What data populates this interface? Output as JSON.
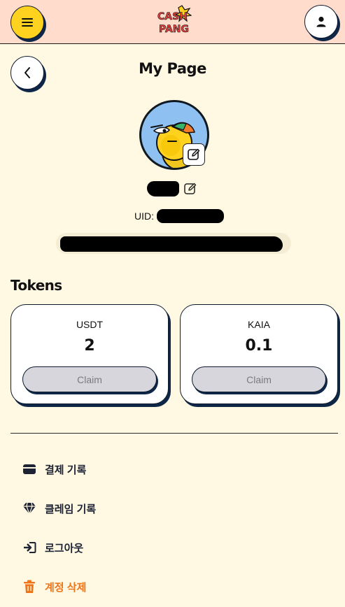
{
  "header": {
    "logo_top": "CASH",
    "logo_bottom": "PANG"
  },
  "page": {
    "title": "My Page"
  },
  "profile": {
    "nickname": "",
    "uid_label": "UID:",
    "uid_value": "",
    "wallet_address": ""
  },
  "tokens": {
    "title": "Tokens",
    "items": [
      {
        "name": "USDT",
        "amount": "2",
        "claim_label": "Claim"
      },
      {
        "name": "KAIA",
        "amount": "0.1",
        "claim_label": "Claim"
      }
    ]
  },
  "menu": {
    "items": [
      {
        "label": "결제 기록",
        "icon": "card-icon"
      },
      {
        "label": "클레임 기록",
        "icon": "diamond-icon"
      },
      {
        "label": "로그아웃",
        "icon": "logout-icon"
      },
      {
        "label": "계정 삭제",
        "icon": "trash-icon"
      }
    ]
  },
  "colors": {
    "header_bg": "#ffdccb",
    "page_bg": "#fff8e2",
    "menu_button": "#ffd21f",
    "danger": "#f07418",
    "claim_disabled": "#d7d6dd"
  }
}
